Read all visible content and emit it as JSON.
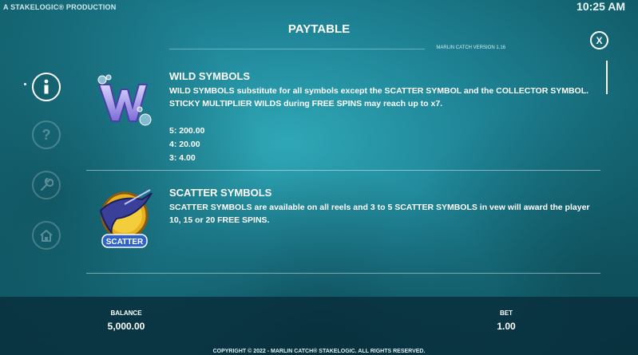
{
  "header": {
    "production": "A STAKELOGIC® PRODUCTION",
    "clock": "10:25 AM",
    "title": "PAYTABLE",
    "version": "MARLIN CATCH VERSION 1.16",
    "close_label": "X"
  },
  "nav": [
    {
      "icon": "info-icon",
      "active": true
    },
    {
      "icon": "help-icon",
      "active": false
    },
    {
      "icon": "settings-icon",
      "active": false
    },
    {
      "icon": "home-icon",
      "active": false
    }
  ],
  "sections": [
    {
      "title": "WILD SYMBOLS",
      "description": "WILD SYMBOLS substitute for all symbols except the SCATTER SYMBOL and the COLLECTOR SYMBOL. STICKY MULTIPLIER WILDS during FREE SPINS may reach up to x7.",
      "payouts": [
        "5: 200.00",
        "4: 20.00",
        "3: 4.00"
      ],
      "icon": "wild-symbol-icon"
    },
    {
      "title": "SCATTER SYMBOLS",
      "description": "SCATTER SYMBOLS are available on all reels and 3 to 5 SCATTER SYMBOLS in vew will award the player 10, 15 or 20 FREE SPINS.",
      "icon": "scatter-symbol-icon",
      "badge": "SCATTER"
    }
  ],
  "footer": {
    "balance_label": "BALANCE",
    "balance_value": "5,000.00",
    "bet_label": "BET",
    "bet_value": "1.00",
    "copyright": "COPYRIGHT © 2022 - MARLIN CATCH® STAKELOGIC. ALL RIGHTS RESERVED."
  },
  "colors": {
    "background": "#1f8597",
    "footer_bar": "#082d3a",
    "text": "#ffffff"
  }
}
